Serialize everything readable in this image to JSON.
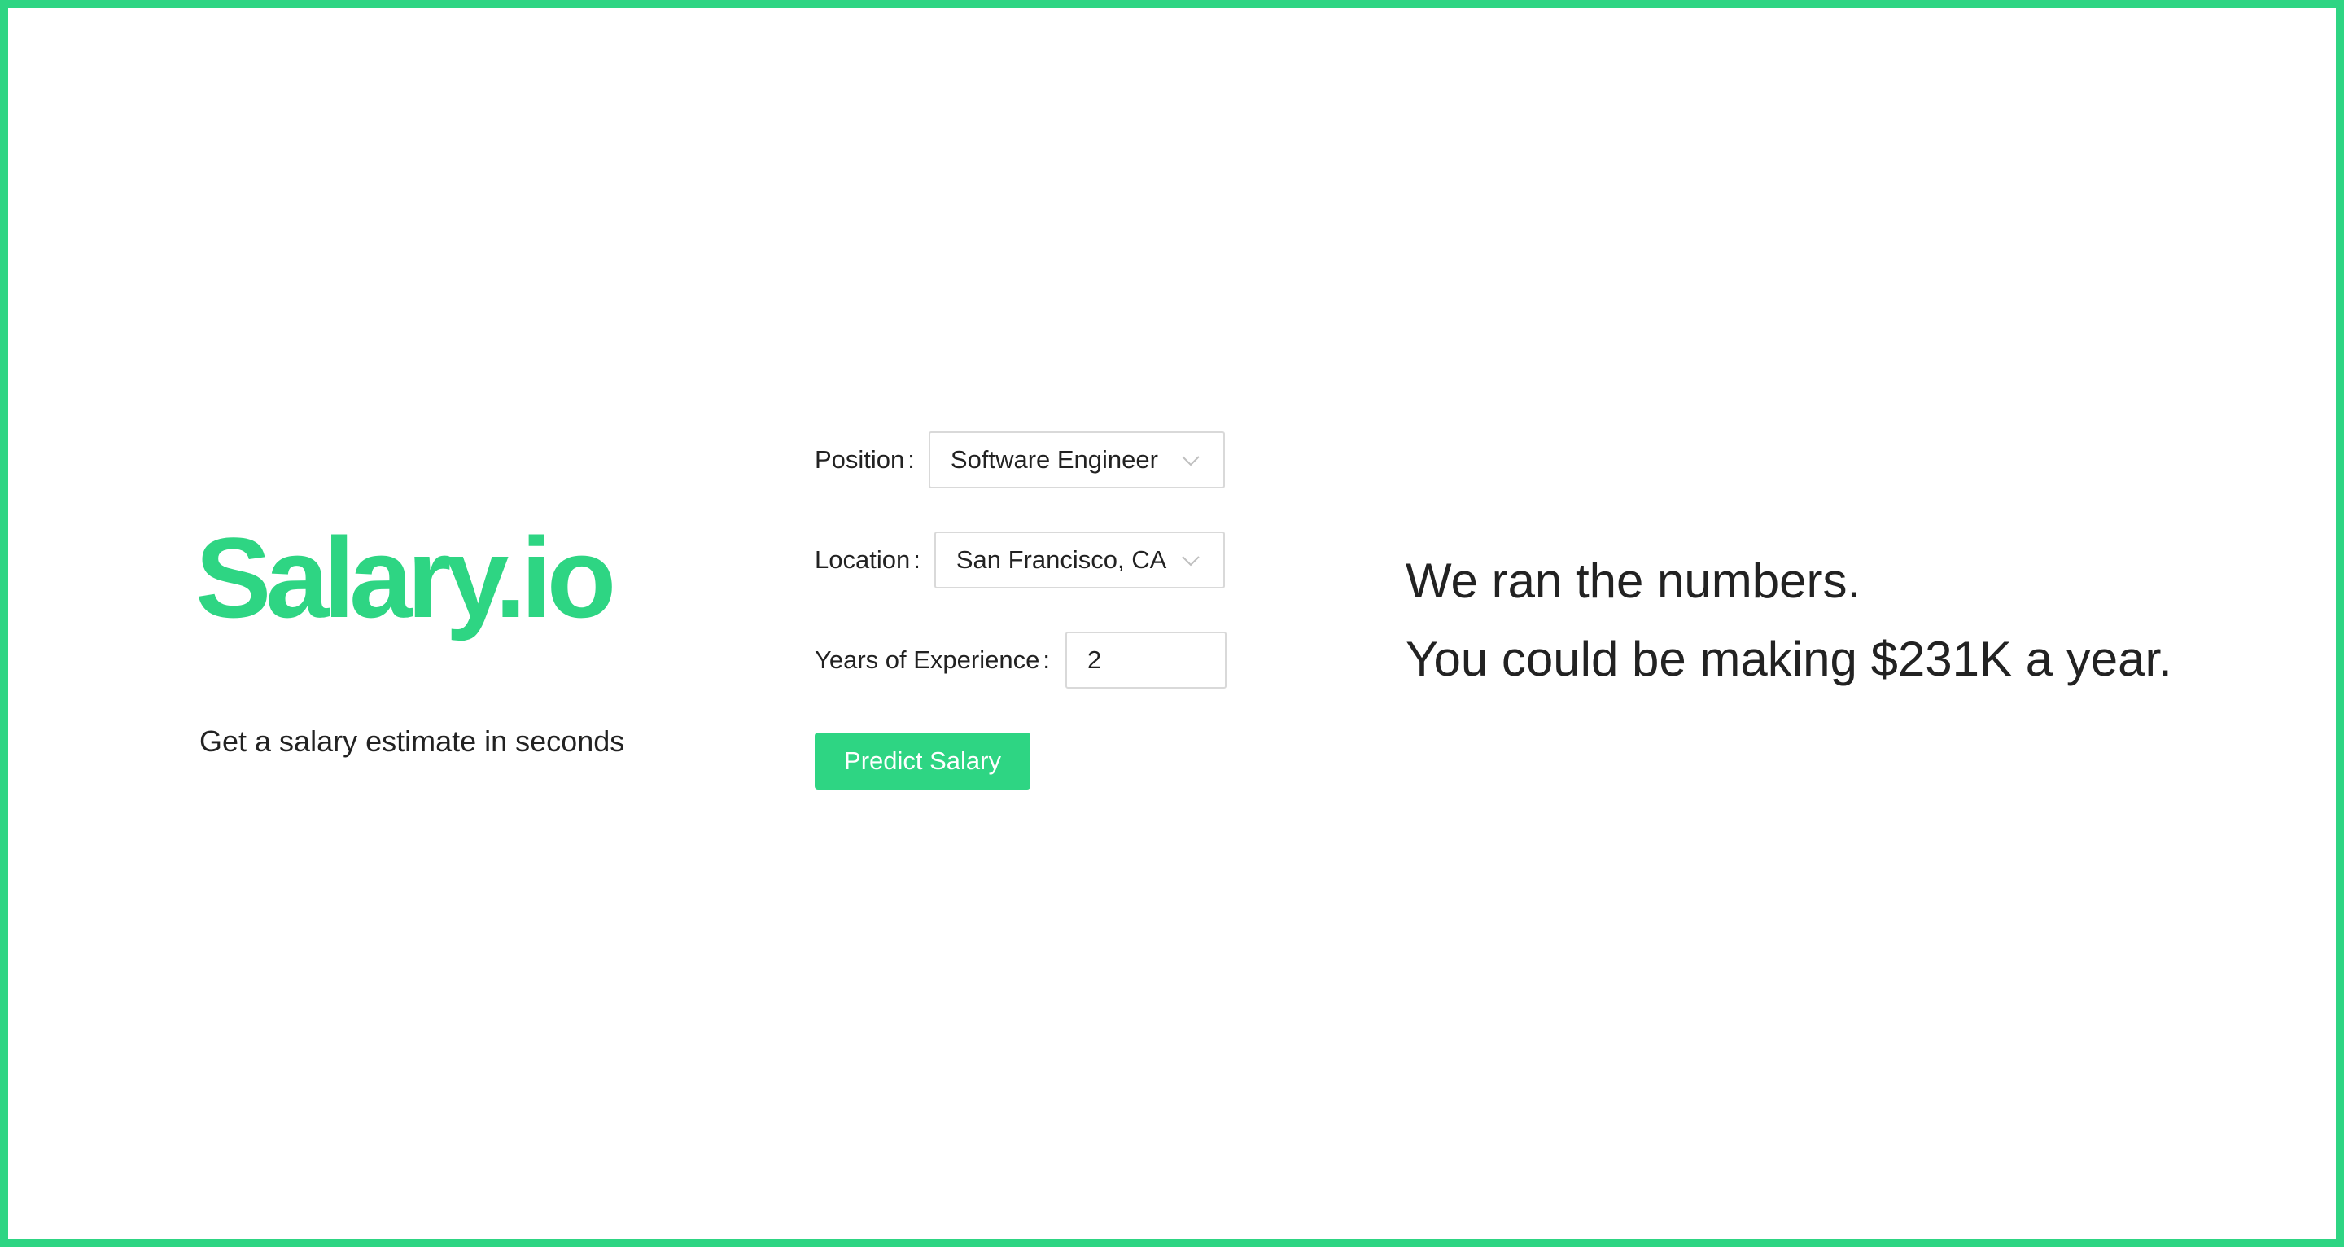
{
  "brand": {
    "name": "Salary.io",
    "tagline": "Get a salary estimate in seconds"
  },
  "form": {
    "position": {
      "label": "Position",
      "colon": ":",
      "selected": "Software Engineer"
    },
    "location": {
      "label": "Location",
      "colon": ":",
      "selected": "San Francisco, CA"
    },
    "years": {
      "label": "Years of Experience",
      "colon": ":",
      "value": "2"
    },
    "submit_label": "Predict Salary"
  },
  "result": {
    "line1": "We ran the numbers.",
    "line2": "You could be making $231K a year."
  },
  "icons": {
    "dropdown": "chevron-down-icon"
  },
  "colors": {
    "accent": "#2ed583",
    "text": "#222222",
    "input_border": "#d9d9d9",
    "button_text": "#ffffff"
  }
}
